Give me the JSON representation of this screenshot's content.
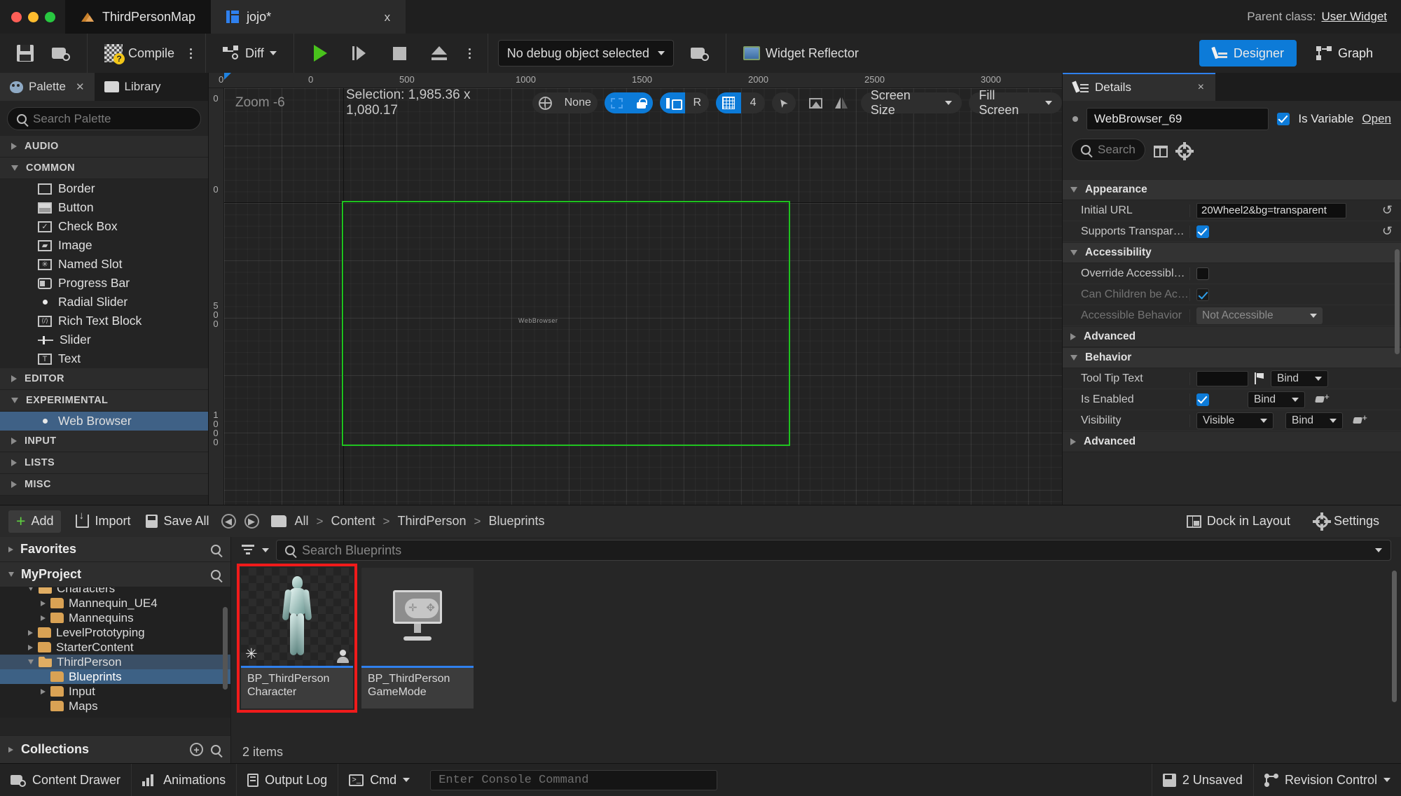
{
  "titlebar": {
    "map_tab": "ThirdPersonMap",
    "widget_tab": "jojo*",
    "close_label": "x",
    "parent_class_label": "Parent class:",
    "parent_class_value": "User Widget"
  },
  "toolbar": {
    "save_tooltip": "Save",
    "browse_tooltip": "Browse",
    "compile_label": "Compile",
    "diff_label": "Diff",
    "debug_object": "No debug object selected",
    "widget_reflector": "Widget Reflector",
    "designer_label": "Designer",
    "graph_label": "Graph",
    "active_mode": "Designer",
    "accent_color": "#0d7bd8"
  },
  "palette": {
    "tabs": [
      {
        "label": "Palette",
        "active": true,
        "icon": "palette-icon",
        "closable": true
      },
      {
        "label": "Library",
        "active": false,
        "icon": "library-icon",
        "closable": false
      }
    ],
    "search_placeholder": "Search Palette",
    "categories": [
      {
        "name": "AUDIO",
        "expanded": false,
        "items": []
      },
      {
        "name": "COMMON",
        "expanded": true,
        "items": [
          {
            "label": "Border",
            "icon": "border-icon"
          },
          {
            "label": "Button",
            "icon": "button-icon"
          },
          {
            "label": "Check Box",
            "icon": "checkbox-icon"
          },
          {
            "label": "Image",
            "icon": "image-icon"
          },
          {
            "label": "Named Slot",
            "icon": "named-slot-icon"
          },
          {
            "label": "Progress Bar",
            "icon": "progress-bar-icon"
          },
          {
            "label": "Radial Slider",
            "icon": "radial-slider-icon"
          },
          {
            "label": "Rich Text Block",
            "icon": "rich-text-icon"
          },
          {
            "label": "Slider",
            "icon": "slider-icon"
          },
          {
            "label": "Text",
            "icon": "text-icon"
          }
        ]
      },
      {
        "name": "EDITOR",
        "expanded": false,
        "items": []
      },
      {
        "name": "EXPERIMENTAL",
        "expanded": true,
        "items": [
          {
            "label": "Web Browser",
            "icon": "web-browser-icon",
            "selected": true
          }
        ]
      },
      {
        "name": "INPUT",
        "expanded": false,
        "items": []
      },
      {
        "name": "LISTS",
        "expanded": false,
        "items": []
      },
      {
        "name": "MISC",
        "expanded": false,
        "items": []
      }
    ]
  },
  "viewport": {
    "zoom_label": "Zoom -6",
    "selection_label": "Selection: 1,985.36 x 1,080.17",
    "localization": "None",
    "dash_toggle_on": true,
    "lock_toggle_on": true,
    "anchor_toggle_on": true,
    "rotation_label": "R",
    "grid_toggle_on": true,
    "grid_value": "4",
    "screen_size_label": "Screen Size",
    "fill_screen_label": "Fill Screen",
    "ruler_top_ticks": [
      "0",
      "0",
      "500",
      "1000",
      "1500",
      "2000",
      "2500",
      "3000"
    ],
    "ruler_left_ticks": [
      "0",
      "0",
      "500",
      "1000"
    ],
    "selection_color": "#1fc21f",
    "canvas_widget_label": "WebBrowser"
  },
  "details": {
    "tab_label": "Details",
    "close_label": "×",
    "object_name": "WebBrowser_69",
    "is_variable_label": "Is Variable",
    "is_variable_checked": true,
    "open_label": "Open",
    "search_placeholder": "Search",
    "sections": [
      {
        "name": "Appearance",
        "expanded": true,
        "rows": [
          {
            "label": "Initial URL",
            "type": "text",
            "value": "20Wheel2&bg=transparent",
            "has_revert": true
          },
          {
            "label": "Supports Transparency",
            "type": "checkbox",
            "checked": true,
            "has_revert": true
          }
        ]
      },
      {
        "name": "Accessibility",
        "expanded": true,
        "rows": [
          {
            "label": "Override Accessible De...",
            "type": "checkbox",
            "checked": false,
            "dim": false
          },
          {
            "label": "Can Children be Access...",
            "type": "checkbox",
            "checked": true,
            "dim": true
          },
          {
            "label": "Accessible Behavior",
            "type": "combo",
            "value": "Not Accessible",
            "dim": true
          }
        ]
      },
      {
        "name": "Advanced",
        "expanded": false,
        "rows": []
      },
      {
        "name": "Behavior",
        "expanded": true,
        "rows": [
          {
            "label": "Tool Tip Text",
            "type": "text",
            "value": "",
            "bind": "Bind",
            "flag": true
          },
          {
            "label": "Is Enabled",
            "type": "checkbox",
            "checked": true,
            "bind": "Bind",
            "pin": true
          },
          {
            "label": "Visibility",
            "type": "combo",
            "value": "Visible",
            "bind": "Bind",
            "pin": true
          }
        ]
      },
      {
        "name": "Advanced",
        "expanded": false,
        "rows": []
      }
    ]
  },
  "content_browser": {
    "add_label": "Add",
    "import_label": "Import",
    "save_all_label": "Save All",
    "breadcrumb": [
      "All",
      "Content",
      "ThirdPerson",
      "Blueprints"
    ],
    "breadcrumb_separator": ">",
    "dock_in_layout_label": "Dock in Layout",
    "settings_label": "Settings",
    "favorites_label": "Favorites",
    "project_label": "MyProject",
    "collections_label": "Collections",
    "tree": [
      {
        "label": "Characters",
        "depth": 1,
        "expanded": true,
        "clipped": true
      },
      {
        "label": "Mannequin_UE4",
        "depth": 2,
        "expanded": false
      },
      {
        "label": "Mannequins",
        "depth": 2,
        "expanded": false
      },
      {
        "label": "LevelPrototyping",
        "depth": 1,
        "expanded": false
      },
      {
        "label": "StarterContent",
        "depth": 1,
        "expanded": false
      },
      {
        "label": "ThirdPerson",
        "depth": 1,
        "expanded": true,
        "highlighted": true
      },
      {
        "label": "Blueprints",
        "depth": 2,
        "selected": true,
        "leaf": true
      },
      {
        "label": "Input",
        "depth": 2,
        "expanded": false
      },
      {
        "label": "Maps",
        "depth": 2,
        "leaf": true
      }
    ],
    "search_placeholder": "Search Blueprints",
    "assets": [
      {
        "name_line1": "BP_ThirdPerson",
        "name_line2": "Character",
        "thumb": "mannequin",
        "selected": true
      },
      {
        "name_line1": "BP_ThirdPerson",
        "name_line2": "GameMode",
        "thumb": "gamemode",
        "selected": false
      }
    ],
    "item_count": "2 items",
    "selection_highlight_color": "#f01b1b"
  },
  "statusbar": {
    "content_drawer": "Content Drawer",
    "animations": "Animations",
    "output_log": "Output Log",
    "cmd_label": "Cmd",
    "console_placeholder": "Enter Console Command",
    "unsaved": "2 Unsaved",
    "revision_control": "Revision Control"
  }
}
